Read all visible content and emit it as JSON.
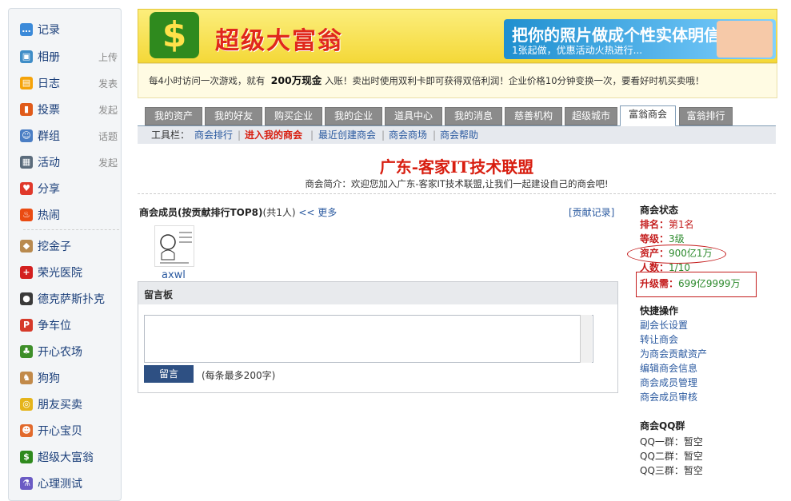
{
  "sidebar": {
    "items": [
      {
        "label": "记录",
        "sub": "",
        "icon": "chat-bubble-icon",
        "color": "#3b8ad9"
      },
      {
        "label": "相册",
        "sub": "上传",
        "icon": "photo-album-icon",
        "color": "#3f8dc7"
      },
      {
        "label": "日志",
        "sub": "发表",
        "icon": "notebook-icon",
        "color": "#f5a30a"
      },
      {
        "label": "投票",
        "sub": "发起",
        "icon": "bar-chart-icon",
        "color": "#e05b1a"
      },
      {
        "label": "群组",
        "sub": "话题",
        "icon": "group-icon",
        "color": "#4a7ec4"
      },
      {
        "label": "活动",
        "sub": "发起",
        "icon": "calendar-icon",
        "color": "#5a6b7b"
      },
      {
        "label": "分享",
        "sub": "",
        "icon": "heart-icon",
        "color": "#e0392b"
      },
      {
        "label": "热闹",
        "sub": "",
        "icon": "fire-icon",
        "color": "#ea4b12"
      },
      {
        "label": "挖金子",
        "sub": "",
        "icon": "gold-mine-icon",
        "color": "#b98a4e"
      },
      {
        "label": "荣光医院",
        "sub": "",
        "icon": "red-cross-icon",
        "color": "#d32020"
      },
      {
        "label": "德克萨斯扑克",
        "sub": "",
        "icon": "poker-chip-icon",
        "color": "#3a3a3a"
      },
      {
        "label": "争车位",
        "sub": "",
        "icon": "parking-icon",
        "color": "#d63a2a"
      },
      {
        "label": "开心农场",
        "sub": "",
        "icon": "sprout-icon",
        "color": "#3e8f2a"
      },
      {
        "label": "狗狗",
        "sub": "",
        "icon": "dog-icon",
        "color": "#c28a4a"
      },
      {
        "label": "朋友买卖",
        "sub": "",
        "icon": "coins-icon",
        "color": "#e5b41b"
      },
      {
        "label": "开心宝贝",
        "sub": "",
        "icon": "baby-icon",
        "color": "#e26a2c"
      },
      {
        "label": "超级大富翁",
        "sub": "",
        "icon": "dollar-icon",
        "color": "#2f8a1e"
      },
      {
        "label": "心理测试",
        "sub": "",
        "icon": "flask-icon",
        "color": "#6b5bc4"
      }
    ]
  },
  "banner": {
    "title": "超级大富翁",
    "ad_title": "把你的照片做成个性实体明信片!",
    "ad_sub": "1张起做，优惠活动火热进行..."
  },
  "notice": {
    "pre": "每4小时访问一次游戏，就有",
    "bold": "200万现金",
    "post": "入账！卖出时使用双利卡即可获得双倍利润！企业价格10分钟变换一次，要看好时机买卖哦！"
  },
  "tabs": [
    "我的资产",
    "我的好友",
    "购买企业",
    "我的企业",
    "道具中心",
    "我的消息",
    "慈善机构",
    "超级城市",
    "富翁商会",
    "富翁排行"
  ],
  "active_tab": "富翁商会",
  "toolbar": {
    "label": "工具栏：",
    "links": [
      "商会排行",
      "进入我的商会",
      "最近创建商会",
      "商会商场",
      "商会帮助"
    ],
    "separator": "|"
  },
  "union": {
    "title": "广东-客家IT技术联盟",
    "intro": "商会简介：欢迎您加入广东-客家IT技术联盟,让我们一起建设自己的商会吧!"
  },
  "members": {
    "heading": "商会成员(按贡献排行TOP8)",
    "count": "(共1人)",
    "more": "<< 更多",
    "contrib_link": "[贡献记录]",
    "member_name": "axwl"
  },
  "board": {
    "title": "留言板",
    "button": "留言",
    "note": "(每条最多200字)"
  },
  "status": {
    "heading": "商会状态",
    "rank_key": "排名：",
    "rank_val": "第1名",
    "level_key": "等级：",
    "level_val": "3级",
    "assets_key": "资产：",
    "assets_val": "900亿1万",
    "people_key": "人数：",
    "people_val": "1/10",
    "upgrade_key": "升级需：",
    "upgrade_val": "699亿9999万"
  },
  "quick": {
    "heading": "快捷操作",
    "links": [
      "副会长设置",
      "转让商会",
      "为商会贡献资产",
      "编辑商会信息",
      "商会成员管理",
      "商会成员审核"
    ]
  },
  "qq": {
    "heading": "商会QQ群",
    "rows": [
      "QQ一群：暂空",
      "QQ二群：暂空",
      "QQ三群：暂空"
    ]
  }
}
